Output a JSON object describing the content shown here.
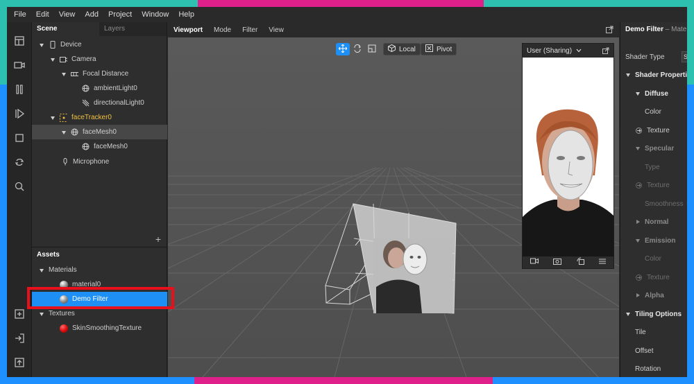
{
  "menu": [
    "File",
    "Edit",
    "View",
    "Add",
    "Project",
    "Window",
    "Help"
  ],
  "colors": {
    "frame_top_left": "#2dbfb0",
    "frame_top_mid": "#e0208a",
    "frame_side": "#1e90ff",
    "accent": "#1e8ff5",
    "highlight_box": "#e8101a"
  },
  "toolbar_icons": [
    "layout-icon",
    "camera-icon",
    "pause-icon",
    "play-step-icon",
    "stop-icon",
    "refresh-icon",
    "search-icon",
    "add-folder-icon",
    "import-icon",
    "export-icon"
  ],
  "scene": {
    "tabs": [
      "Scene",
      "Layers"
    ],
    "tree": [
      {
        "label": "Device",
        "icon": "phone-icon"
      },
      {
        "label": "Camera",
        "icon": "camera-icon"
      },
      {
        "label": "Focal Distance",
        "icon": "focal-distance-icon"
      },
      {
        "label": "ambientLight0",
        "icon": "ambient-light-icon"
      },
      {
        "label": "directionalLight0",
        "icon": "directional-light-icon"
      },
      {
        "label": "faceTracker0",
        "icon": "face-tracker-icon"
      },
      {
        "label": "faceMesh0",
        "icon": "mesh-icon"
      },
      {
        "label": "faceMesh0",
        "icon": "mesh-icon"
      },
      {
        "label": "Microphone",
        "icon": "microphone-icon"
      }
    ],
    "add_label": "+"
  },
  "assets": {
    "title": "Assets",
    "groups": [
      {
        "label": "Materials",
        "items": [
          "material0",
          "Demo Filter"
        ]
      },
      {
        "label": "Textures",
        "items": [
          "SkinSmoothingTexture"
        ]
      }
    ]
  },
  "viewport": {
    "tabs": [
      "Viewport",
      "Mode",
      "Filter",
      "View"
    ],
    "buttons": {
      "local": "Local",
      "pivot": "Pivot"
    }
  },
  "preview": {
    "label": "User (Sharing)"
  },
  "inspector": {
    "title": "Demo Filter",
    "title_suffix": "– Mate",
    "shader_type_label": "Shader Type",
    "shader_type_value": "S",
    "rows": [
      "Shader Properties",
      "Diffuse",
      "Color",
      "Texture",
      "Specular",
      "Type",
      "Texture",
      "Smoothness",
      "Normal",
      "Emission",
      "Color",
      "Texture",
      "Alpha",
      "Tiling Options",
      "Tile",
      "Offset",
      "Rotation"
    ]
  }
}
